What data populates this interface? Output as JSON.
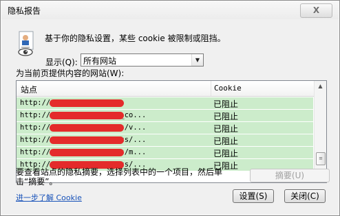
{
  "window": {
    "title": "隐私报告",
    "close_glyph": "X"
  },
  "info": {
    "message": "基于你的隐私设置，某些 cookie 被限制或阻挡。",
    "icon": "privacy-report-icon"
  },
  "filter": {
    "label": "显示(Q):",
    "selected": "所有网站"
  },
  "list": {
    "caption": "为当前页提供内容的网站(W):",
    "columns": [
      "站点",
      "Cookie"
    ],
    "rows": [
      {
        "url": "http://              /bcse_edu/",
        "status": "已阻止"
      },
      {
        "url": "http://              /bcse_edu/bower_co...",
        "status": "已阻止"
      },
      {
        "url": "http://              /bcse_edu/styles/v...",
        "status": "已阻止"
      },
      {
        "url": "http://              /bcse_edu/scripts/...",
        "status": "已阻止"
      },
      {
        "url": "http://              /bcse_edu/styles/m...",
        "status": "已阻止"
      },
      {
        "url": "http://              /bcse_edu/scripts/...",
        "status": "已阻止"
      }
    ]
  },
  "summary": {
    "instruction": "要查看站点的隐私摘要，选择列表中的一个项目，然后单击“摘要”。",
    "button_label": "摘要(U)"
  },
  "footer": {
    "learn_more": "进一步了解 Cookie",
    "settings_label": "设置(S)",
    "close_label": "关闭(C)"
  },
  "colors": {
    "row_highlight": "#cceccb",
    "redaction": "#e42b2b",
    "link": "#1550b8"
  }
}
